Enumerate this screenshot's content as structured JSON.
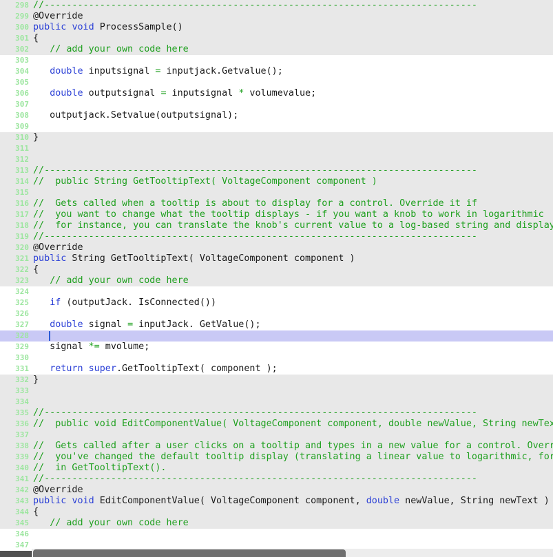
{
  "editor": {
    "current_line": "328",
    "lines": [
      {
        "n": "298",
        "bg": "gray",
        "t": [
          [
            "cm",
            "//------------------------------------------------------------------------------"
          ]
        ]
      },
      {
        "n": "299",
        "bg": "gray",
        "t": [
          [
            "an",
            "@Override"
          ]
        ]
      },
      {
        "n": "300",
        "bg": "gray",
        "t": [
          [
            "kw",
            "public"
          ],
          [
            "tx",
            " "
          ],
          [
            "kw",
            "void"
          ],
          [
            "tx",
            " ProcessSample()"
          ]
        ]
      },
      {
        "n": "301",
        "bg": "gray",
        "t": [
          [
            "tx",
            "{"
          ]
        ]
      },
      {
        "n": "302",
        "bg": "gray",
        "t": [
          [
            "tx",
            "   "
          ],
          [
            "cm",
            "// add your own code here"
          ]
        ]
      },
      {
        "n": "303",
        "bg": "white",
        "t": []
      },
      {
        "n": "304",
        "bg": "white",
        "t": [
          [
            "tx",
            "   "
          ],
          [
            "kw",
            "double"
          ],
          [
            "tx",
            " inputsignal "
          ],
          [
            "op",
            "="
          ],
          [
            "tx",
            " inputjack.Getvalue();"
          ]
        ]
      },
      {
        "n": "305",
        "bg": "white",
        "t": []
      },
      {
        "n": "306",
        "bg": "white",
        "t": [
          [
            "tx",
            "   "
          ],
          [
            "kw",
            "double"
          ],
          [
            "tx",
            " outputsignal "
          ],
          [
            "op",
            "="
          ],
          [
            "tx",
            " inputsignal "
          ],
          [
            "op",
            "*"
          ],
          [
            "tx",
            " volumevalue;"
          ]
        ]
      },
      {
        "n": "307",
        "bg": "white",
        "t": []
      },
      {
        "n": "308",
        "bg": "white",
        "t": [
          [
            "tx",
            "   outputjack.Setvalue(outputsignal);"
          ]
        ]
      },
      {
        "n": "309",
        "bg": "white",
        "t": []
      },
      {
        "n": "310",
        "bg": "gray",
        "t": [
          [
            "tx",
            "}"
          ]
        ]
      },
      {
        "n": "311",
        "bg": "gray",
        "t": []
      },
      {
        "n": "312",
        "bg": "gray",
        "t": []
      },
      {
        "n": "313",
        "bg": "gray",
        "t": [
          [
            "cm",
            "//------------------------------------------------------------------------------"
          ]
        ]
      },
      {
        "n": "314",
        "bg": "gray",
        "t": [
          [
            "cm",
            "//  public String GetTooltipText( VoltageComponent component )"
          ]
        ]
      },
      {
        "n": "315",
        "bg": "gray",
        "t": []
      },
      {
        "n": "316",
        "bg": "gray",
        "t": [
          [
            "cm",
            "//  Gets called when a tooltip is about to display for a control. Override it if"
          ]
        ]
      },
      {
        "n": "317",
        "bg": "gray",
        "t": [
          [
            "cm",
            "//  you want to change what the tooltip displays - if you want a knob to work in logarithmic"
          ]
        ]
      },
      {
        "n": "318",
        "bg": "gray",
        "t": [
          [
            "cm",
            "//  for instance, you can translate the knob's current value to a log-based string and display"
          ]
        ]
      },
      {
        "n": "319",
        "bg": "gray",
        "t": [
          [
            "cm",
            "//------------------------------------------------------------------------------"
          ]
        ]
      },
      {
        "n": "320",
        "bg": "gray",
        "t": [
          [
            "an",
            "@Override"
          ]
        ]
      },
      {
        "n": "321",
        "bg": "gray",
        "t": [
          [
            "kw",
            "public"
          ],
          [
            "tx",
            " String GetTooltipText( VoltageComponent component )"
          ]
        ]
      },
      {
        "n": "322",
        "bg": "gray",
        "t": [
          [
            "tx",
            "{"
          ]
        ]
      },
      {
        "n": "323",
        "bg": "gray",
        "t": [
          [
            "tx",
            "   "
          ],
          [
            "cm",
            "// add your own code here"
          ]
        ]
      },
      {
        "n": "324",
        "bg": "white",
        "t": []
      },
      {
        "n": "325",
        "bg": "white",
        "t": [
          [
            "tx",
            "   "
          ],
          [
            "kw",
            "if"
          ],
          [
            "tx",
            " (outputJack. IsConnected())"
          ]
        ]
      },
      {
        "n": "326",
        "bg": "white",
        "t": []
      },
      {
        "n": "327",
        "bg": "white",
        "t": [
          [
            "tx",
            "   "
          ],
          [
            "kw",
            "double"
          ],
          [
            "tx",
            " signal "
          ],
          [
            "op",
            "="
          ],
          [
            "tx",
            " inputJack. GetValue();"
          ]
        ]
      },
      {
        "n": "328",
        "bg": "current",
        "t": []
      },
      {
        "n": "329",
        "bg": "white",
        "t": [
          [
            "tx",
            "   signal "
          ],
          [
            "op",
            "*="
          ],
          [
            "tx",
            " mvolume;"
          ]
        ]
      },
      {
        "n": "330",
        "bg": "white",
        "t": []
      },
      {
        "n": "331",
        "bg": "white",
        "t": [
          [
            "tx",
            "   "
          ],
          [
            "kw",
            "return"
          ],
          [
            "tx",
            " "
          ],
          [
            "kw",
            "super"
          ],
          [
            "tx",
            ".GetTooltipText( component );"
          ]
        ]
      },
      {
        "n": "332",
        "bg": "gray",
        "t": [
          [
            "tx",
            "}"
          ]
        ]
      },
      {
        "n": "333",
        "bg": "gray",
        "t": []
      },
      {
        "n": "334",
        "bg": "gray",
        "t": []
      },
      {
        "n": "335",
        "bg": "gray",
        "t": [
          [
            "cm",
            "//------------------------------------------------------------------------------"
          ]
        ]
      },
      {
        "n": "336",
        "bg": "gray",
        "t": [
          [
            "cm",
            "//  public void EditComponentValue( VoltageComponent component, double newValue, String newText )"
          ]
        ]
      },
      {
        "n": "337",
        "bg": "gray",
        "t": []
      },
      {
        "n": "338",
        "bg": "gray",
        "t": [
          [
            "cm",
            "//  Gets called after a user clicks on a tooltip and types in a new value for a control. Override"
          ]
        ]
      },
      {
        "n": "339",
        "bg": "gray",
        "t": [
          [
            "cm",
            "//  you've changed the default tooltip display (translating a linear value to logarithmic, for"
          ]
        ]
      },
      {
        "n": "340",
        "bg": "gray",
        "t": [
          [
            "cm",
            "//  in GetTooltipText()."
          ]
        ]
      },
      {
        "n": "341",
        "bg": "gray",
        "t": [
          [
            "cm",
            "//------------------------------------------------------------------------------"
          ]
        ]
      },
      {
        "n": "342",
        "bg": "gray",
        "t": [
          [
            "an",
            "@Override"
          ]
        ]
      },
      {
        "n": "343",
        "bg": "gray",
        "t": [
          [
            "kw",
            "public"
          ],
          [
            "tx",
            " "
          ],
          [
            "kw",
            "void"
          ],
          [
            "tx",
            " EditComponentValue( VoltageComponent component, "
          ],
          [
            "kw",
            "double"
          ],
          [
            "tx",
            " newValue, String newText )"
          ]
        ]
      },
      {
        "n": "344",
        "bg": "gray",
        "t": [
          [
            "tx",
            "{"
          ]
        ]
      },
      {
        "n": "345",
        "bg": "gray",
        "t": [
          [
            "tx",
            "   "
          ],
          [
            "cm",
            "// add your own code here"
          ]
        ]
      },
      {
        "n": "346",
        "bg": "white",
        "t": []
      },
      {
        "n": "347",
        "bg": "white",
        "t": []
      }
    ]
  }
}
